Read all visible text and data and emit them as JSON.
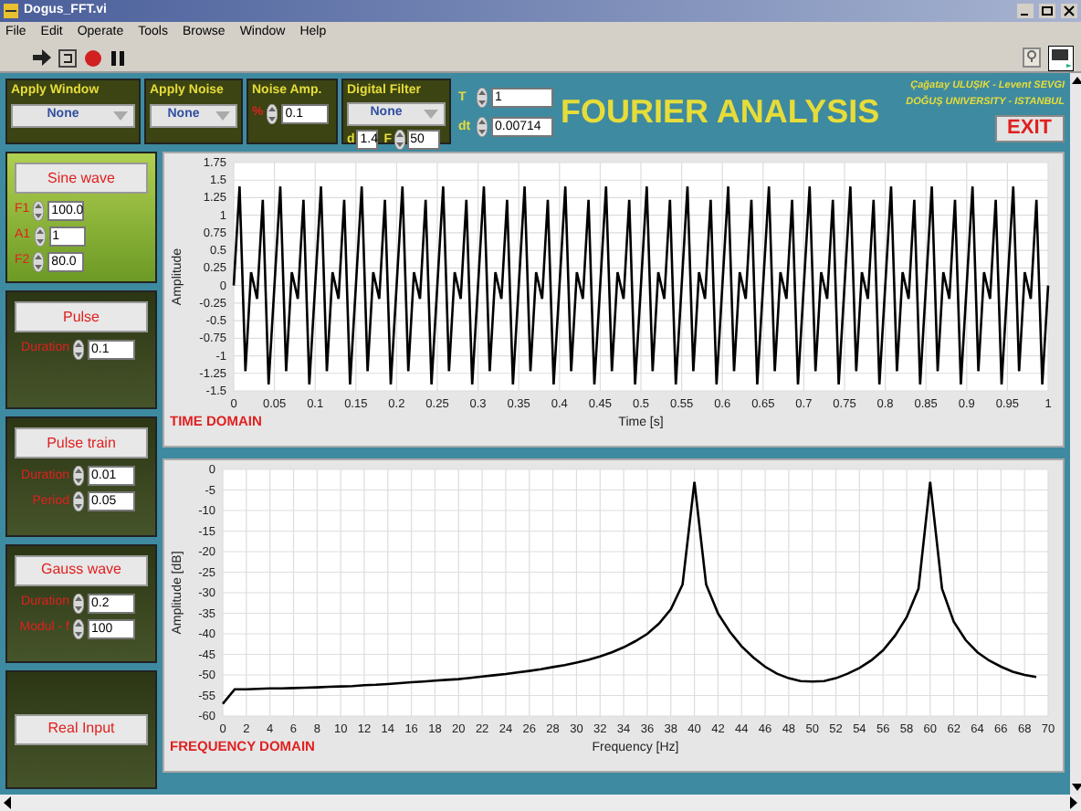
{
  "window": {
    "title": "Dogus_FFT.vi"
  },
  "menu": [
    "File",
    "Edit",
    "Operate",
    "Tools",
    "Browse",
    "Window",
    "Help"
  ],
  "controls": {
    "apply_window": {
      "label": "Apply Window",
      "value": "None"
    },
    "apply_noise": {
      "label": "Apply Noise",
      "value": "None"
    },
    "noise_amp": {
      "label": "Noise Amp.",
      "unit": "%",
      "value": "0.1"
    },
    "digital_filter": {
      "label": "Digital Filter",
      "value": "None",
      "d_label": "d",
      "d_value": "1.4",
      "f_label": "F",
      "f_value": "50"
    },
    "t": {
      "label": "T",
      "value": "1"
    },
    "dt": {
      "label": "dt",
      "value": "0.00714"
    }
  },
  "header": {
    "title": "FOURIER ANALYSIS",
    "credits": [
      "Çağatay ULUŞIK - Levent SEVGI",
      "DOĞUŞ UNIVERSITY - ISTANBUL"
    ],
    "exit": "EXIT"
  },
  "signals": [
    {
      "button": "Sine wave",
      "selected": true,
      "params": [
        {
          "label": "F1",
          "value": "100.0"
        },
        {
          "label": "A1",
          "value": "1"
        },
        {
          "label": "F2",
          "value": "80.0"
        }
      ]
    },
    {
      "button": "Pulse",
      "selected": false,
      "params": [
        {
          "label": "Duration",
          "value": "0.1"
        }
      ]
    },
    {
      "button": "Pulse train",
      "selected": false,
      "params": [
        {
          "label": "Duration",
          "value": "0.01"
        },
        {
          "label": "Period",
          "value": "0.05"
        }
      ]
    },
    {
      "button": "Gauss wave",
      "selected": false,
      "params": [
        {
          "label": "Duration",
          "value": "0.2"
        },
        {
          "label": "Modul - f",
          "value": "100"
        }
      ]
    },
    {
      "button": "Real Input",
      "selected": false
    }
  ],
  "charts": [
    {
      "chart_data": {
        "type": "line",
        "title": "TIME DOMAIN",
        "xlabel": "Time [s]",
        "ylabel": "Amplitude",
        "grid": true,
        "xlim": [
          0,
          1
        ],
        "ylim": [
          -1.5,
          1.75
        ],
        "x": [
          0,
          0.0071,
          0.0143,
          0.0214,
          0.0286,
          0.0357,
          0.0429,
          0.05,
          0.0571,
          0.0643,
          0.0714,
          0.0786,
          0.0857,
          0.0929,
          0.1,
          0.1071,
          0.1143,
          0.1214,
          0.1286,
          0.1357,
          0.1429,
          0.15,
          0.1571,
          0.1643,
          0.1714,
          0.1786,
          0.1857,
          0.1929,
          0.2,
          0.2071,
          0.2143,
          0.2214,
          0.2286,
          0.2357,
          0.2429,
          0.25,
          0.2571,
          0.2643,
          0.2714,
          0.2786,
          0.2857,
          0.2929,
          0.3,
          0.3071,
          0.3143,
          0.3214,
          0.3286,
          0.3357,
          0.3429,
          0.35,
          0.3571,
          0.3643,
          0.3714,
          0.3786,
          0.3857,
          0.3929,
          0.4,
          0.4071,
          0.4143,
          0.4214,
          0.4286,
          0.4357,
          0.4429,
          0.45,
          0.4571,
          0.4643,
          0.4714,
          0.4786,
          0.4857,
          0.4929,
          0.5,
          0.5071,
          0.5143,
          0.5214,
          0.5286,
          0.5357,
          0.5429,
          0.55,
          0.5571,
          0.5643,
          0.5714,
          0.5786,
          0.5857,
          0.5929,
          0.6,
          0.6071,
          0.6143,
          0.6214,
          0.6286,
          0.6357,
          0.6429,
          0.65,
          0.6571,
          0.6643,
          0.6714,
          0.6786,
          0.6857,
          0.6929,
          0.7,
          0.7071,
          0.7143,
          0.7214,
          0.7286,
          0.7357,
          0.7429,
          0.75,
          0.7571,
          0.7643,
          0.7714,
          0.7786,
          0.7857,
          0.7929,
          0.8,
          0.8071,
          0.8143,
          0.8214,
          0.8286,
          0.8357,
          0.8429,
          0.85,
          0.8571,
          0.8643,
          0.8714,
          0.8786,
          0.8857,
          0.8929,
          0.9,
          0.9071,
          0.9143,
          0.9214,
          0.9286,
          0.9357,
          0.9429,
          0.95,
          0.9571,
          0.9643,
          0.9714,
          0.9786,
          0.9857,
          0.9929,
          1
        ],
        "xticks": [
          0,
          0.05,
          0.1,
          0.15,
          0.2,
          0.25,
          0.3,
          0.35,
          0.4,
          0.45,
          0.5,
          0.55,
          0.6,
          0.65,
          0.7,
          0.75,
          0.8,
          0.85,
          0.9,
          0.95,
          1
        ],
        "yticks": [
          -1.5,
          -1.25,
          -1,
          -0.75,
          -0.5,
          -0.25,
          0,
          0.25,
          0.5,
          0.75,
          1,
          1.25,
          1.5,
          1.75
        ],
        "values": [
          0,
          1.41,
          -1.22,
          0.19,
          -0.19,
          1.22,
          -1.41,
          0,
          1.41,
          -1.22,
          0.19,
          -0.19,
          1.22,
          -1.41,
          0,
          1.41,
          -1.22,
          0.19,
          -0.19,
          1.22,
          -1.41,
          0,
          1.41,
          -1.22,
          0.19,
          -0.19,
          1.22,
          -1.41,
          0,
          1.41,
          -1.22,
          0.19,
          -0.19,
          1.22,
          -1.41,
          0,
          1.41,
          -1.22,
          0.19,
          -0.19,
          1.22,
          -1.41,
          0,
          1.41,
          -1.22,
          0.19,
          -0.19,
          1.22,
          -1.41,
          0,
          1.41,
          -1.22,
          0.19,
          -0.19,
          1.22,
          -1.41,
          0,
          1.41,
          -1.22,
          0.19,
          -0.19,
          1.22,
          -1.41,
          0,
          1.41,
          -1.22,
          0.19,
          -0.19,
          1.22,
          -1.41,
          0,
          1.41,
          -1.22,
          0.19,
          -0.19,
          1.22,
          -1.41,
          0,
          1.41,
          -1.22,
          0.19,
          -0.19,
          1.22,
          -1.41,
          0,
          1.41,
          -1.22,
          0.19,
          -0.19,
          1.22,
          -1.41,
          0,
          1.41,
          -1.22,
          0.19,
          -0.19,
          1.22,
          -1.41,
          0,
          1.41,
          -1.22,
          0.19,
          -0.19,
          1.22,
          -1.41,
          0,
          1.41,
          -1.22,
          0.19,
          -0.19,
          1.22,
          -1.41,
          0,
          1.41,
          -1.22,
          0.19,
          -0.19,
          1.22,
          -1.41,
          0,
          1.41,
          -1.22,
          0.19,
          -0.19,
          1.22,
          -1.41,
          0,
          1.41,
          -1.22,
          0.19,
          -0.19,
          1.22,
          -1.41,
          0,
          1.41,
          -1.22,
          0.19,
          -0.19,
          1.22,
          -1.41,
          0
        ]
      }
    },
    {
      "chart_data": {
        "type": "line",
        "title": "FREQUENCY DOMAIN",
        "xlabel": "Frequency [Hz]",
        "ylabel": "Amplitude [dB]",
        "grid": true,
        "xlim": [
          0,
          70
        ],
        "ylim": [
          -60,
          0
        ],
        "xticks": [
          0,
          2,
          4,
          6,
          8,
          10,
          12,
          14,
          16,
          18,
          20,
          22,
          24,
          26,
          28,
          30,
          32,
          34,
          36,
          38,
          40,
          42,
          44,
          46,
          48,
          50,
          52,
          54,
          56,
          58,
          60,
          62,
          64,
          66,
          68,
          70
        ],
        "yticks": [
          -60,
          -55,
          -50,
          -45,
          -40,
          -35,
          -30,
          -25,
          -20,
          -15,
          -10,
          -5,
          0
        ],
        "x": [
          0,
          1,
          2,
          3,
          4,
          5,
          6,
          7,
          8,
          9,
          10,
          11,
          12,
          13,
          14,
          15,
          16,
          17,
          18,
          19,
          20,
          21,
          22,
          23,
          24,
          25,
          26,
          27,
          28,
          29,
          30,
          31,
          32,
          33,
          34,
          35,
          36,
          37,
          38,
          39,
          40,
          41,
          42,
          43,
          44,
          45,
          46,
          47,
          48,
          49,
          50,
          51,
          52,
          53,
          54,
          55,
          56,
          57,
          58,
          59,
          60,
          61,
          62,
          63,
          64,
          65,
          66,
          67,
          68,
          69
        ],
        "values": [
          -57,
          -53.5,
          -53.5,
          -53.4,
          -53.3,
          -53.3,
          -53.2,
          -53.1,
          -53,
          -52.9,
          -52.8,
          -52.7,
          -52.5,
          -52.4,
          -52.2,
          -52,
          -51.8,
          -51.6,
          -51.4,
          -51.2,
          -51,
          -50.7,
          -50.4,
          -50.1,
          -49.8,
          -49.4,
          -49,
          -48.6,
          -48.1,
          -47.6,
          -47,
          -46.3,
          -45.5,
          -44.5,
          -43.3,
          -41.8,
          -40,
          -37.5,
          -34,
          -28,
          -3,
          -28,
          -35,
          -39.5,
          -43,
          -45.8,
          -48,
          -49.7,
          -50.8,
          -51.5,
          -51.6,
          -51.5,
          -50.8,
          -49.7,
          -48.3,
          -46.5,
          -44,
          -40.5,
          -36,
          -29,
          -3,
          -29,
          -37,
          -41.5,
          -44.5,
          -46.5,
          -48,
          -49.2,
          -50,
          -50.5
        ]
      }
    }
  ]
}
